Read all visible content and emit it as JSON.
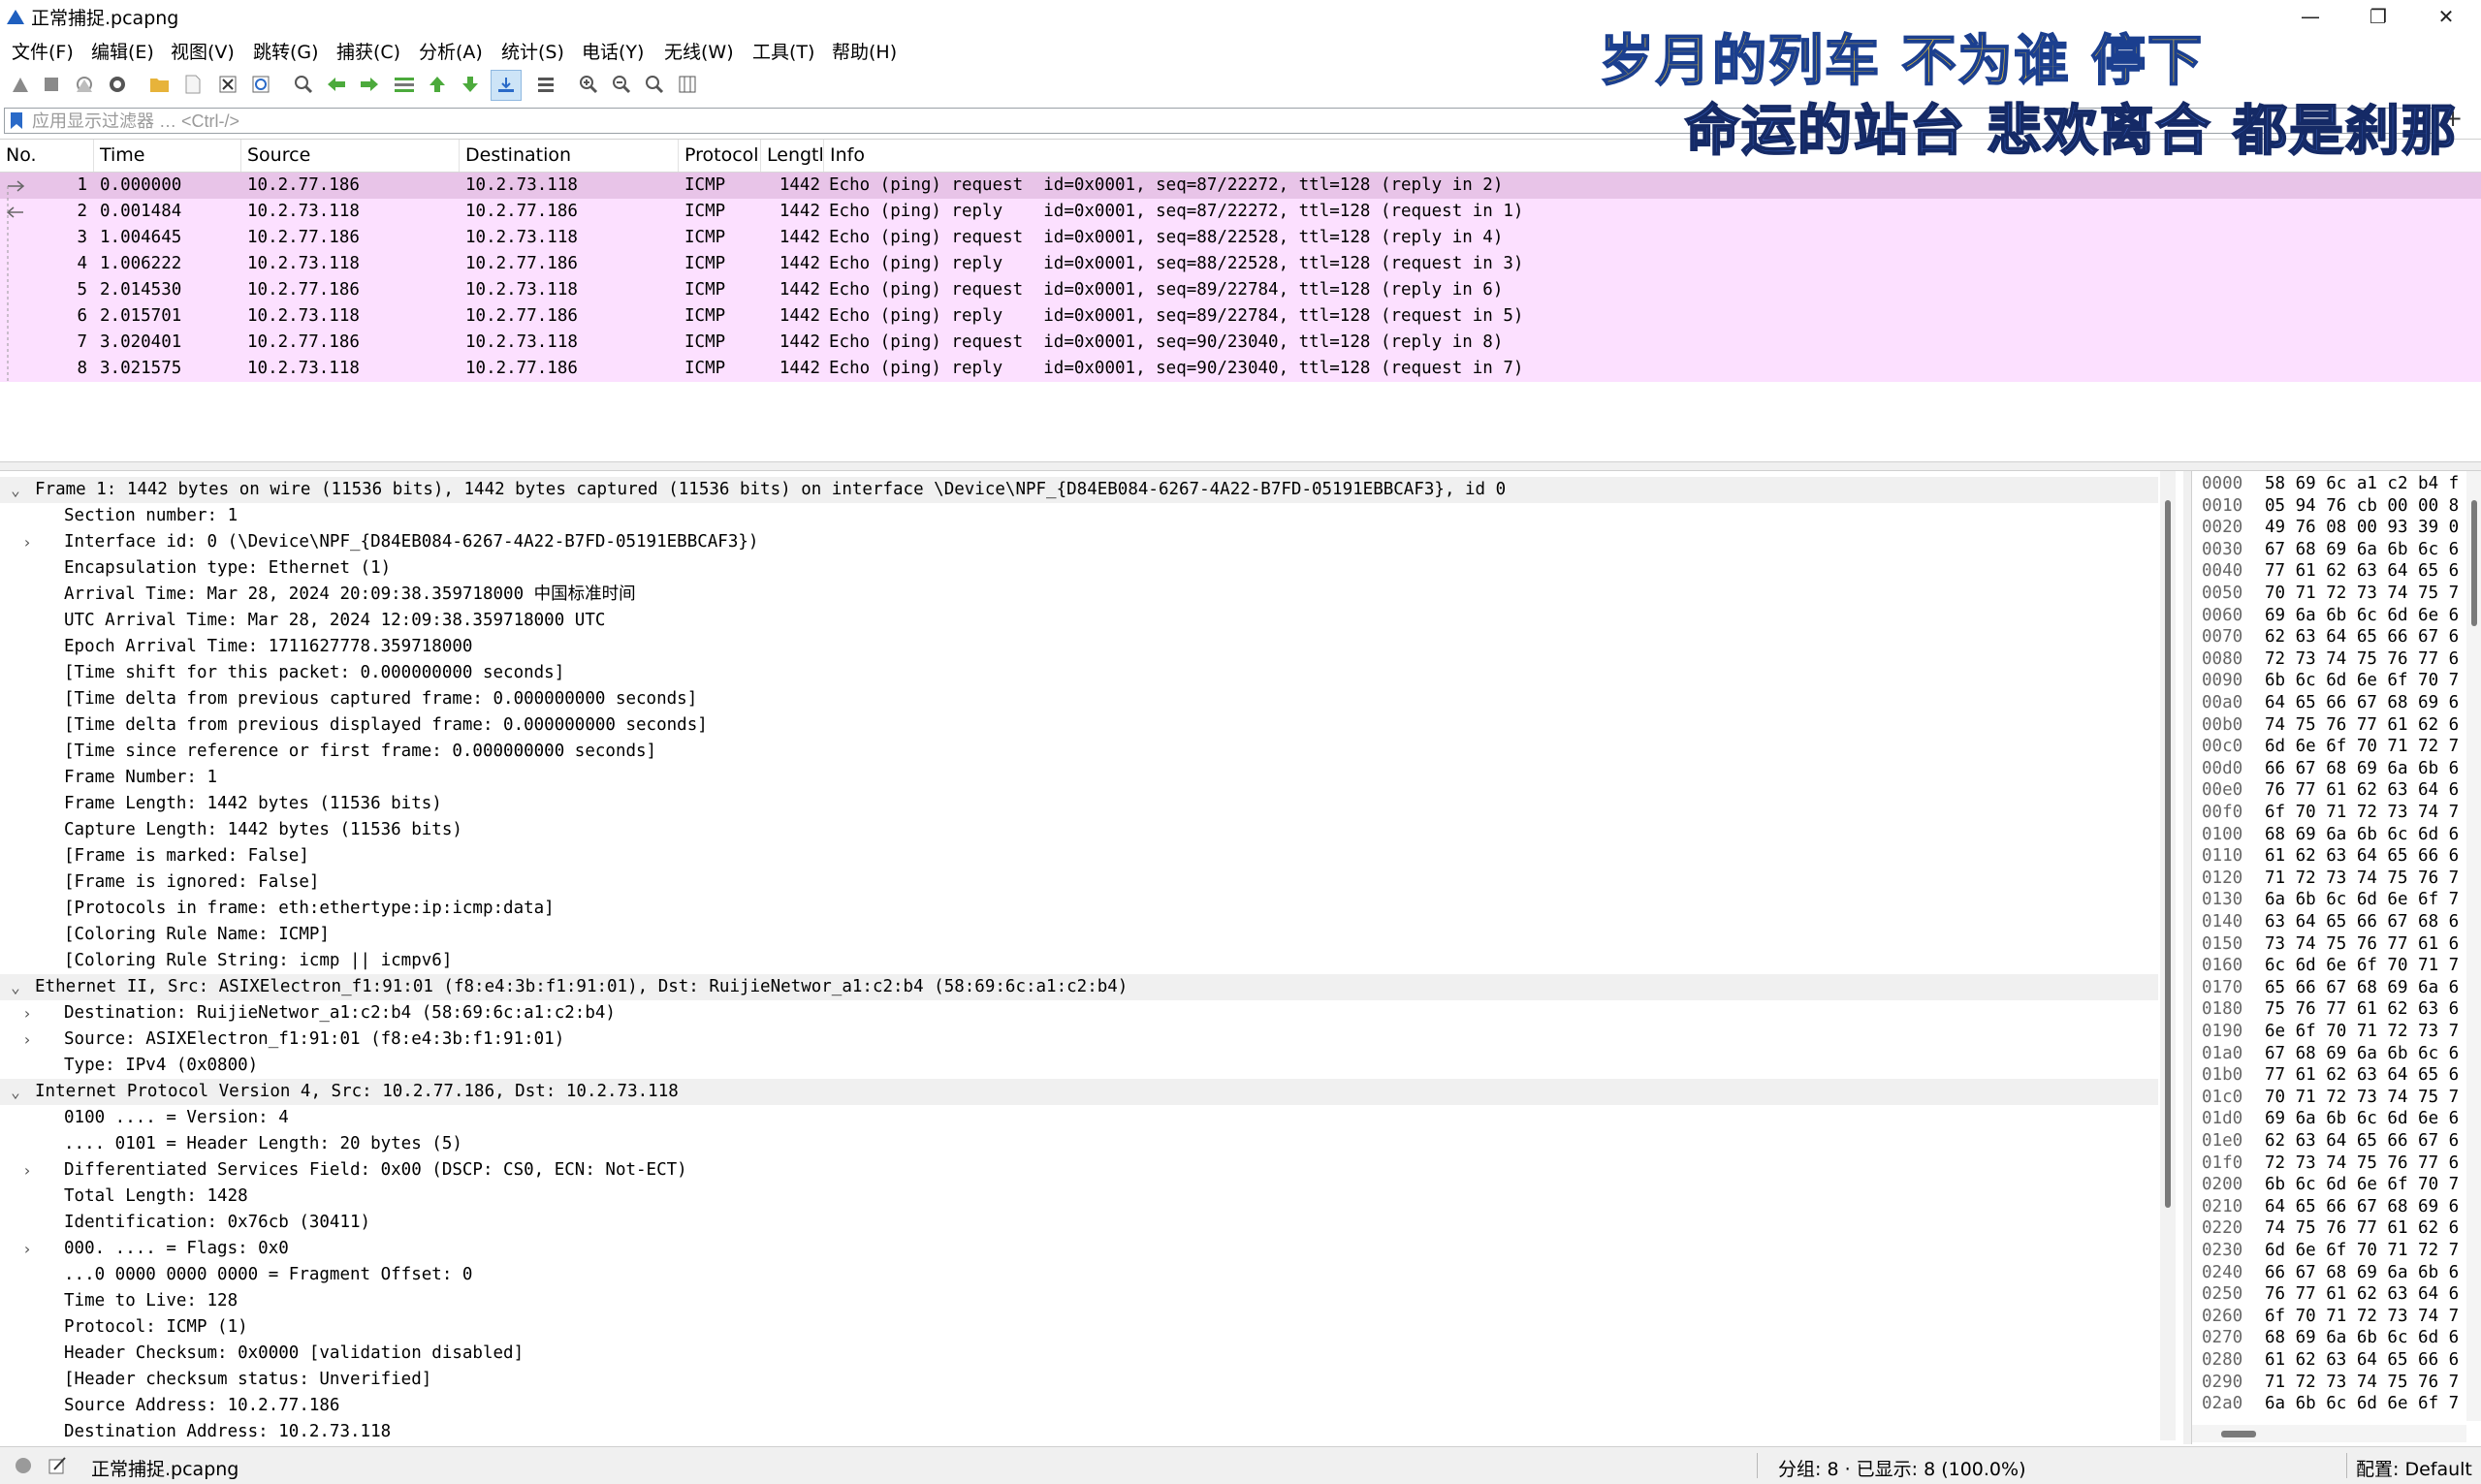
{
  "window": {
    "title": "正常捕捉.pcapng",
    "minimize_glyph": "—",
    "maximize_glyph": "❐",
    "close_glyph": "✕"
  },
  "menu": [
    "文件(F)",
    "编辑(E)",
    "视图(V)",
    "跳转(G)",
    "捕获(C)",
    "分析(A)",
    "统计(S)",
    "电话(Y)",
    "无线(W)",
    "工具(T)",
    "帮助(H)"
  ],
  "toolbar": {
    "icons": [
      "start-capture-icon",
      "stop-capture-icon",
      "restart-capture-icon",
      "capture-options-icon",
      "open-file-icon",
      "save-file-icon",
      "close-file-icon",
      "reload-file-icon",
      "find-packet-icon",
      "go-back-icon",
      "go-forward-icon",
      "go-to-packet-icon",
      "go-first-icon",
      "go-last-icon",
      "autoscroll-icon",
      "colorize-icon",
      "zoom-in-icon",
      "zoom-out-icon",
      "zoom-normal-icon",
      "resize-columns-icon"
    ]
  },
  "filter": {
    "placeholder": "应用显示过滤器 … <Ctrl-/>",
    "value": "",
    "add_button": "+",
    "dropdown_glyph": "▾"
  },
  "packet_list": {
    "columns": [
      "No.",
      "Time",
      "Source",
      "Destination",
      "Protocol",
      "Lengtl",
      "Info"
    ],
    "rows": [
      {
        "no": "1",
        "time": "0.000000",
        "src": "10.2.77.186",
        "dst": "10.2.73.118",
        "proto": "ICMP",
        "len": "1442",
        "info": "Echo (ping) request  id=0x0001, seq=87/22272, ttl=128 (reply in 2)",
        "selected": true
      },
      {
        "no": "2",
        "time": "0.001484",
        "src": "10.2.73.118",
        "dst": "10.2.77.186",
        "proto": "ICMP",
        "len": "1442",
        "info": "Echo (ping) reply    id=0x0001, seq=87/22272, ttl=128 (request in 1)",
        "selected": false
      },
      {
        "no": "3",
        "time": "1.004645",
        "src": "10.2.77.186",
        "dst": "10.2.73.118",
        "proto": "ICMP",
        "len": "1442",
        "info": "Echo (ping) request  id=0x0001, seq=88/22528, ttl=128 (reply in 4)",
        "selected": false
      },
      {
        "no": "4",
        "time": "1.006222",
        "src": "10.2.73.118",
        "dst": "10.2.77.186",
        "proto": "ICMP",
        "len": "1442",
        "info": "Echo (ping) reply    id=0x0001, seq=88/22528, ttl=128 (request in 3)",
        "selected": false
      },
      {
        "no": "5",
        "time": "2.014530",
        "src": "10.2.77.186",
        "dst": "10.2.73.118",
        "proto": "ICMP",
        "len": "1442",
        "info": "Echo (ping) request  id=0x0001, seq=89/22784, ttl=128 (reply in 6)",
        "selected": false
      },
      {
        "no": "6",
        "time": "2.015701",
        "src": "10.2.73.118",
        "dst": "10.2.77.186",
        "proto": "ICMP",
        "len": "1442",
        "info": "Echo (ping) reply    id=0x0001, seq=89/22784, ttl=128 (request in 5)",
        "selected": false
      },
      {
        "no": "7",
        "time": "3.020401",
        "src": "10.2.77.186",
        "dst": "10.2.73.118",
        "proto": "ICMP",
        "len": "1442",
        "info": "Echo (ping) request  id=0x0001, seq=90/23040, ttl=128 (reply in 8)",
        "selected": false
      },
      {
        "no": "8",
        "time": "3.021575",
        "src": "10.2.73.118",
        "dst": "10.2.77.186",
        "proto": "ICMP",
        "len": "1442",
        "info": "Echo (ping) reply    id=0x0001, seq=90/23040, ttl=128 (request in 7)",
        "selected": false
      }
    ],
    "row_color": "#fce0ff",
    "selected_color": "#e8c4e8"
  },
  "details": {
    "rows": [
      {
        "level": 0,
        "arrow": "⌄",
        "text": "Frame 1: 1442 bytes on wire (11536 bits), 1442 bytes captured (11536 bits) on interface \\Device\\NPF_{D84EB084-6267-4A22-B7FD-05191EBBCAF3}, id 0",
        "header": true
      },
      {
        "level": 1,
        "arrow": "",
        "text": "Section number: 1"
      },
      {
        "level": 1,
        "arrow": "›",
        "text": "Interface id: 0 (\\Device\\NPF_{D84EB084-6267-4A22-B7FD-05191EBBCAF3})"
      },
      {
        "level": 1,
        "arrow": "",
        "text": "Encapsulation type: Ethernet (1)"
      },
      {
        "level": 1,
        "arrow": "",
        "text": "Arrival Time: Mar 28, 2024 20:09:38.359718000 中国标准时间"
      },
      {
        "level": 1,
        "arrow": "",
        "text": "UTC Arrival Time: Mar 28, 2024 12:09:38.359718000 UTC"
      },
      {
        "level": 1,
        "arrow": "",
        "text": "Epoch Arrival Time: 1711627778.359718000"
      },
      {
        "level": 1,
        "arrow": "",
        "text": "[Time shift for this packet: 0.000000000 seconds]"
      },
      {
        "level": 1,
        "arrow": "",
        "text": "[Time delta from previous captured frame: 0.000000000 seconds]"
      },
      {
        "level": 1,
        "arrow": "",
        "text": "[Time delta from previous displayed frame: 0.000000000 seconds]"
      },
      {
        "level": 1,
        "arrow": "",
        "text": "[Time since reference or first frame: 0.000000000 seconds]"
      },
      {
        "level": 1,
        "arrow": "",
        "text": "Frame Number: 1"
      },
      {
        "level": 1,
        "arrow": "",
        "text": "Frame Length: 1442 bytes (11536 bits)"
      },
      {
        "level": 1,
        "arrow": "",
        "text": "Capture Length: 1442 bytes (11536 bits)"
      },
      {
        "level": 1,
        "arrow": "",
        "text": "[Frame is marked: False]"
      },
      {
        "level": 1,
        "arrow": "",
        "text": "[Frame is ignored: False]"
      },
      {
        "level": 1,
        "arrow": "",
        "text": "[Protocols in frame: eth:ethertype:ip:icmp:data]"
      },
      {
        "level": 1,
        "arrow": "",
        "text": "[Coloring Rule Name: ICMP]"
      },
      {
        "level": 1,
        "arrow": "",
        "text": "[Coloring Rule String: icmp || icmpv6]"
      },
      {
        "level": 0,
        "arrow": "⌄",
        "text": "Ethernet II, Src: ASIXElectron_f1:91:01 (f8:e4:3b:f1:91:01), Dst: RuijieNetwor_a1:c2:b4 (58:69:6c:a1:c2:b4)",
        "header": true
      },
      {
        "level": 1,
        "arrow": "›",
        "text": "Destination: RuijieNetwor_a1:c2:b4 (58:69:6c:a1:c2:b4)"
      },
      {
        "level": 1,
        "arrow": "›",
        "text": "Source: ASIXElectron_f1:91:01 (f8:e4:3b:f1:91:01)"
      },
      {
        "level": 1,
        "arrow": "",
        "text": "Type: IPv4 (0x0800)"
      },
      {
        "level": 0,
        "arrow": "⌄",
        "text": "Internet Protocol Version 4, Src: 10.2.77.186, Dst: 10.2.73.118",
        "header": true
      },
      {
        "level": 1,
        "arrow": "",
        "text": "0100 .... = Version: 4"
      },
      {
        "level": 1,
        "arrow": "",
        "text": ".... 0101 = Header Length: 20 bytes (5)"
      },
      {
        "level": 1,
        "arrow": "›",
        "text": "Differentiated Services Field: 0x00 (DSCP: CS0, ECN: Not-ECT)"
      },
      {
        "level": 1,
        "arrow": "",
        "text": "Total Length: 1428"
      },
      {
        "level": 1,
        "arrow": "",
        "text": "Identification: 0x76cb (30411)"
      },
      {
        "level": 1,
        "arrow": "›",
        "text": "000. .... = Flags: 0x0"
      },
      {
        "level": 1,
        "arrow": "",
        "text": "...0 0000 0000 0000 = Fragment Offset: 0"
      },
      {
        "level": 1,
        "arrow": "",
        "text": "Time to Live: 128"
      },
      {
        "level": 1,
        "arrow": "",
        "text": "Protocol: ICMP (1)"
      },
      {
        "level": 1,
        "arrow": "",
        "text": "Header Checksum: 0x0000 [validation disabled]"
      },
      {
        "level": 1,
        "arrow": "",
        "text": "[Header checksum status: Unverified]"
      },
      {
        "level": 1,
        "arrow": "",
        "text": "Source Address: 10.2.77.186"
      },
      {
        "level": 1,
        "arrow": "",
        "text": "Destination Address: 10.2.73.118"
      }
    ]
  },
  "bytes": {
    "rows": [
      {
        "off": "0000",
        "hex": "58 69 6c a1 c2 b4 f"
      },
      {
        "off": "0010",
        "hex": "05 94 76 cb 00 00 8"
      },
      {
        "off": "0020",
        "hex": "49 76 08 00 93 39 0"
      },
      {
        "off": "0030",
        "hex": "67 68 69 6a 6b 6c 6"
      },
      {
        "off": "0040",
        "hex": "77 61 62 63 64 65 6"
      },
      {
        "off": "0050",
        "hex": "70 71 72 73 74 75 7"
      },
      {
        "off": "0060",
        "hex": "69 6a 6b 6c 6d 6e 6"
      },
      {
        "off": "0070",
        "hex": "62 63 64 65 66 67 6"
      },
      {
        "off": "0080",
        "hex": "72 73 74 75 76 77 6"
      },
      {
        "off": "0090",
        "hex": "6b 6c 6d 6e 6f 70 7"
      },
      {
        "off": "00a0",
        "hex": "64 65 66 67 68 69 6"
      },
      {
        "off": "00b0",
        "hex": "74 75 76 77 61 62 6"
      },
      {
        "off": "00c0",
        "hex": "6d 6e 6f 70 71 72 7"
      },
      {
        "off": "00d0",
        "hex": "66 67 68 69 6a 6b 6"
      },
      {
        "off": "00e0",
        "hex": "76 77 61 62 63 64 6"
      },
      {
        "off": "00f0",
        "hex": "6f 70 71 72 73 74 7"
      },
      {
        "off": "0100",
        "hex": "68 69 6a 6b 6c 6d 6"
      },
      {
        "off": "0110",
        "hex": "61 62 63 64 65 66 6"
      },
      {
        "off": "0120",
        "hex": "71 72 73 74 75 76 7"
      },
      {
        "off": "0130",
        "hex": "6a 6b 6c 6d 6e 6f 7"
      },
      {
        "off": "0140",
        "hex": "63 64 65 66 67 68 6"
      },
      {
        "off": "0150",
        "hex": "73 74 75 76 77 61 6"
      },
      {
        "off": "0160",
        "hex": "6c 6d 6e 6f 70 71 7"
      },
      {
        "off": "0170",
        "hex": "65 66 67 68 69 6a 6"
      },
      {
        "off": "0180",
        "hex": "75 76 77 61 62 63 6"
      },
      {
        "off": "0190",
        "hex": "6e 6f 70 71 72 73 7"
      },
      {
        "off": "01a0",
        "hex": "67 68 69 6a 6b 6c 6"
      },
      {
        "off": "01b0",
        "hex": "77 61 62 63 64 65 6"
      },
      {
        "off": "01c0",
        "hex": "70 71 72 73 74 75 7"
      },
      {
        "off": "01d0",
        "hex": "69 6a 6b 6c 6d 6e 6"
      },
      {
        "off": "01e0",
        "hex": "62 63 64 65 66 67 6"
      },
      {
        "off": "01f0",
        "hex": "72 73 74 75 76 77 6"
      },
      {
        "off": "0200",
        "hex": "6b 6c 6d 6e 6f 70 7"
      },
      {
        "off": "0210",
        "hex": "64 65 66 67 68 69 6"
      },
      {
        "off": "0220",
        "hex": "74 75 76 77 61 62 6"
      },
      {
        "off": "0230",
        "hex": "6d 6e 6f 70 71 72 7"
      },
      {
        "off": "0240",
        "hex": "66 67 68 69 6a 6b 6"
      },
      {
        "off": "0250",
        "hex": "76 77 61 62 63 64 6"
      },
      {
        "off": "0260",
        "hex": "6f 70 71 72 73 74 7"
      },
      {
        "off": "0270",
        "hex": "68 69 6a 6b 6c 6d 6"
      },
      {
        "off": "0280",
        "hex": "61 62 63 64 65 66 6"
      },
      {
        "off": "0290",
        "hex": "71 72 73 74 75 76 7"
      },
      {
        "off": "02a0",
        "hex": "6a 6b 6c 6d 6e 6f 7"
      }
    ]
  },
  "status": {
    "file": "正常捕捉.pcapng",
    "packets": "分组: 8 · 已显示: 8 (100.0%)",
    "profile": "配置: Default"
  },
  "overlay": {
    "line1": "岁月的列车 不为谁 停下",
    "line2": "命运的站台 悲欢离合 都是刹那"
  }
}
